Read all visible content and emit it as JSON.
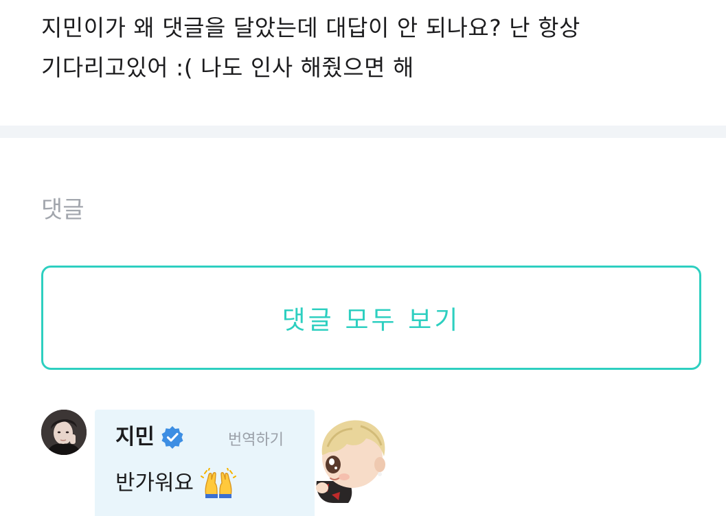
{
  "post": {
    "line1": "지민이가 왜 댓글을 달았는데 대답이 안 되나요? 난 항상",
    "line2": "기다리고있어 :( 나도 인사 해줬으면 해"
  },
  "comments_section": {
    "heading": "댓글",
    "view_all_label": "댓글 모두 보기"
  },
  "comment": {
    "author": "지민",
    "verified": true,
    "translate_label": "번역하기",
    "body": "반가워요",
    "emoji": "raising-hands-icon",
    "sticker": "character-sticker"
  },
  "colors": {
    "accent": "#2dcfc0",
    "verified_badge": "#3d8ee3",
    "bubble_bg": "#e9f5fb",
    "divider": "#f1f4f7",
    "muted_text": "#a2a6ad"
  }
}
